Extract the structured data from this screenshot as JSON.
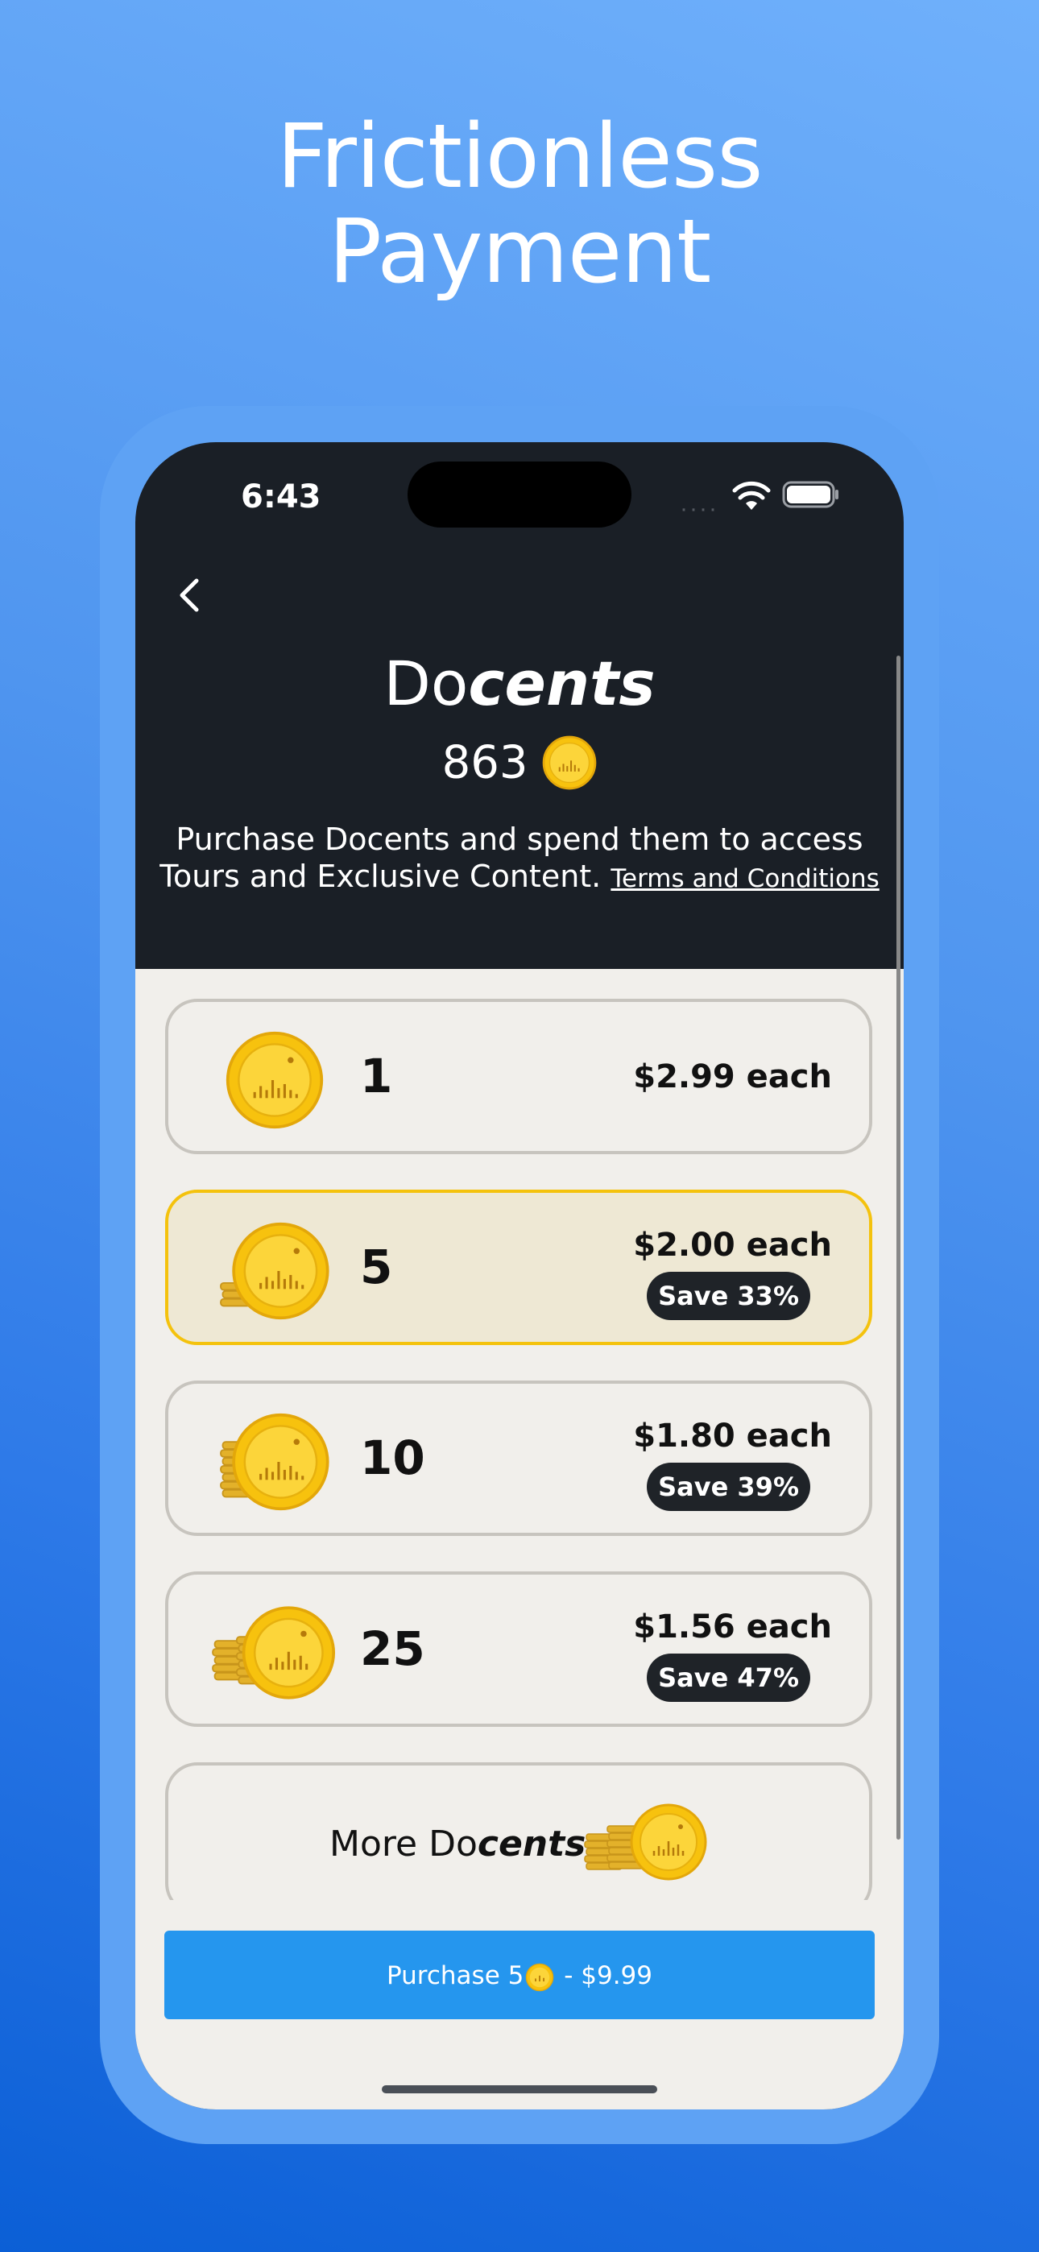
{
  "headline": {
    "line1": "Frictionless",
    "line2": "Payment"
  },
  "status_bar": {
    "time": "6:43",
    "dots": "····"
  },
  "header": {
    "title_plain": "Do",
    "title_bold": "cents",
    "balance": "863",
    "description": "Purchase Docents and spend them to access Tours and Exclusive Content.",
    "terms_link": "Terms and Conditions"
  },
  "packages": [
    {
      "count": "1",
      "price": "$2.99 each",
      "save": ""
    },
    {
      "count": "5",
      "price": "$2.00 each",
      "save": "Save 33%"
    },
    {
      "count": "10",
      "price": "$1.80 each",
      "save": "Save 39%"
    },
    {
      "count": "25",
      "price": "$1.56 each",
      "save": "Save 47%"
    }
  ],
  "selected_package": 1,
  "more": {
    "label_plain": "More Do",
    "label_bold": "cents"
  },
  "purchase": {
    "label_prefix": "Purchase 5",
    "label_suffix": " - $9.99"
  },
  "colors": {
    "accent": "#2596ee",
    "selected_border": "#f4c20d",
    "coin": "#f7c20e"
  },
  "icons": {
    "back": "chevron-left-icon",
    "wifi": "wifi-icon",
    "battery": "battery-icon",
    "coin": "coin-icon"
  }
}
